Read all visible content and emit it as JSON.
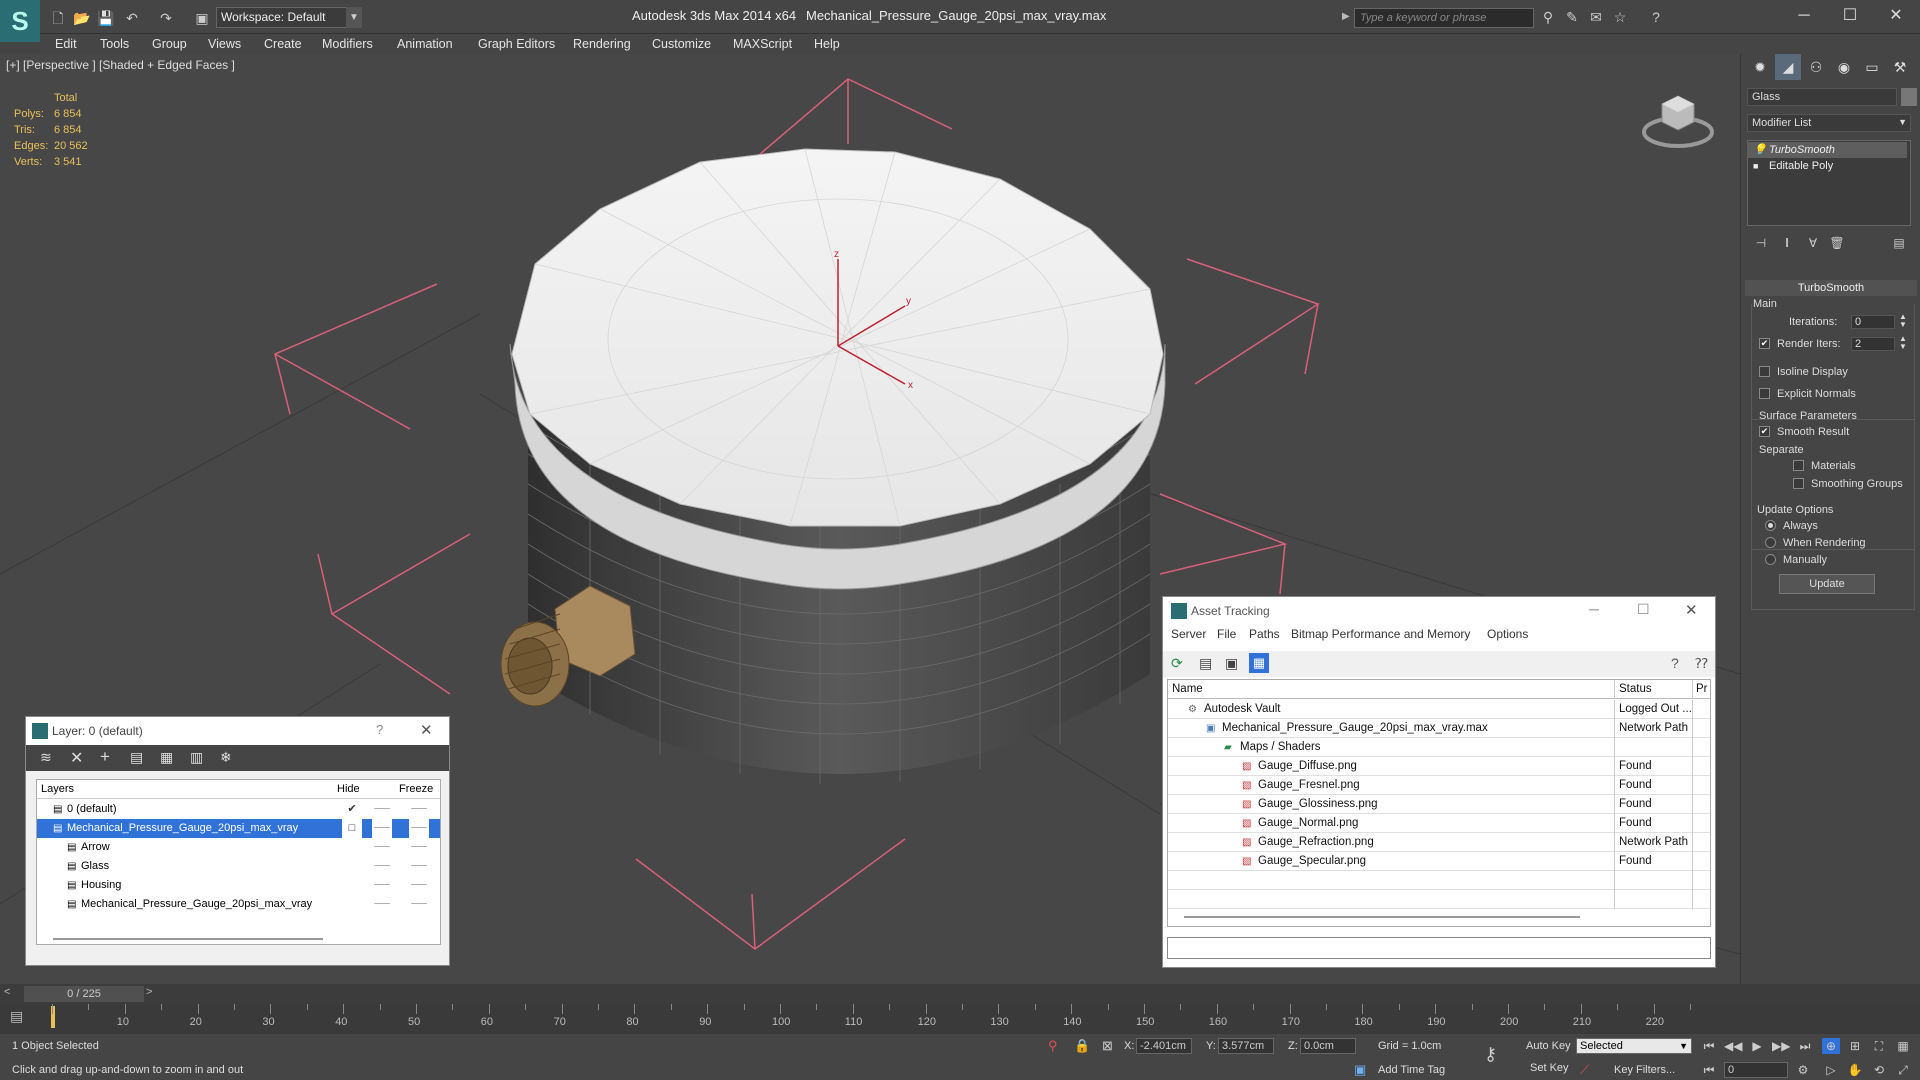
{
  "title_bar": {
    "workspace": "Workspace: Default",
    "app_title": "Autodesk 3ds Max  2014 x64",
    "file_title": "Mechanical_Pressure_Gauge_20psi_max_vray.max",
    "search_placeholder": "Type a keyword or phrase"
  },
  "menu": [
    "Edit",
    "Tools",
    "Group",
    "Views",
    "Create",
    "Modifiers",
    "Animation",
    "Graph Editors",
    "Rendering",
    "Customize",
    "MAXScript",
    "Help"
  ],
  "viewport": {
    "label": "[+] [Perspective ] [Shaded + Edged Faces ]",
    "stats_header": "Total",
    "stats": [
      {
        "k": "Polys:",
        "v": "6 854"
      },
      {
        "k": "Tris:",
        "v": "6 854"
      },
      {
        "k": "Edges:",
        "v": "20 562"
      },
      {
        "k": "Verts:",
        "v": "3 541"
      }
    ],
    "axes": {
      "x": "x",
      "y": "y",
      "z": "z"
    }
  },
  "command_panel": {
    "object_name": "Glass",
    "modifier_list": "Modifier List",
    "stack": [
      "TurboSmooth",
      "Editable Poly"
    ],
    "rollout_title": "TurboSmooth",
    "main_group": "Main",
    "iterations_label": "Iterations:",
    "iterations_value": "0",
    "render_iters_label": "Render Iters:",
    "render_iters_value": "2",
    "isoline": "Isoline Display",
    "explicit_normals": "Explicit Normals",
    "surface_params": "Surface Parameters",
    "smooth_result": "Smooth Result",
    "separate": "Separate",
    "materials": "Materials",
    "smoothing_groups": "Smoothing Groups",
    "update_options": "Update Options",
    "always": "Always",
    "when_rendering": "When Rendering",
    "manually": "Manually",
    "update_btn": "Update"
  },
  "layer_window": {
    "title": "Layer: 0 (default)",
    "help": "?",
    "col_layers": "Layers",
    "col_hide": "Hide",
    "col_freeze": "Freeze",
    "rows": [
      {
        "name": "0 (default)",
        "indent": 1,
        "selected": false,
        "check": "✔"
      },
      {
        "name": "Mechanical_Pressure_Gauge_20psi_max_vray",
        "indent": 1,
        "selected": true,
        "check": "□"
      },
      {
        "name": "Arrow",
        "indent": 2,
        "selected": false,
        "check": ""
      },
      {
        "name": "Glass",
        "indent": 2,
        "selected": false,
        "check": ""
      },
      {
        "name": "Housing",
        "indent": 2,
        "selected": false,
        "check": ""
      },
      {
        "name": "Mechanical_Pressure_Gauge_20psi_max_vray",
        "indent": 2,
        "selected": false,
        "check": ""
      }
    ]
  },
  "asset_window": {
    "title": "Asset Tracking",
    "menu": [
      "Server",
      "File",
      "Paths",
      "Bitmap Performance and Memory",
      "Options"
    ],
    "col_name": "Name",
    "col_status": "Status",
    "col_pr": "Pr",
    "rows": [
      {
        "name": "Autodesk Vault",
        "status": "Logged Out ...",
        "indent": 0
      },
      {
        "name": "Mechanical_Pressure_Gauge_20psi_max_vray.max",
        "status": "Network Path",
        "indent": 1
      },
      {
        "name": "Maps / Shaders",
        "status": "",
        "indent": 2
      },
      {
        "name": "Gauge_Diffuse.png",
        "status": "Found",
        "indent": 3
      },
      {
        "name": "Gauge_Fresnel.png",
        "status": "Found",
        "indent": 3
      },
      {
        "name": "Gauge_Glossiness.png",
        "status": "Found",
        "indent": 3
      },
      {
        "name": "Gauge_Normal.png",
        "status": "Found",
        "indent": 3
      },
      {
        "name": "Gauge_Refraction.png",
        "status": "Network Path",
        "indent": 3
      },
      {
        "name": "Gauge_Specular.png",
        "status": "Found",
        "indent": 3
      }
    ]
  },
  "timeline": {
    "slider": "0 / 225",
    "ticks": [
      10,
      20,
      30,
      40,
      50,
      60,
      70,
      80,
      90,
      100,
      110,
      120,
      130,
      140,
      150,
      160,
      170,
      180,
      190,
      200,
      210,
      220
    ]
  },
  "status": {
    "selected": "1 Object Selected",
    "hint": "Click and drag up-and-down to zoom in and out",
    "x_label": "X:",
    "x_val": "-2.401cm",
    "y_label": "Y:",
    "y_val": "3.577cm",
    "z_label": "Z:",
    "z_val": "0.0cm",
    "grid": "Grid = 1.0cm",
    "auto_key": "Auto Key",
    "selected_mode": "Selected",
    "set_key": "Set Key",
    "key_filters": "Key Filters...",
    "add_time_tag": "Add Time Tag",
    "frame": "0"
  },
  "colors": {
    "accent": "#2a6d73",
    "selection": "#3072d8",
    "stats": "#e8c05a",
    "gizmo": "#d8607a"
  }
}
